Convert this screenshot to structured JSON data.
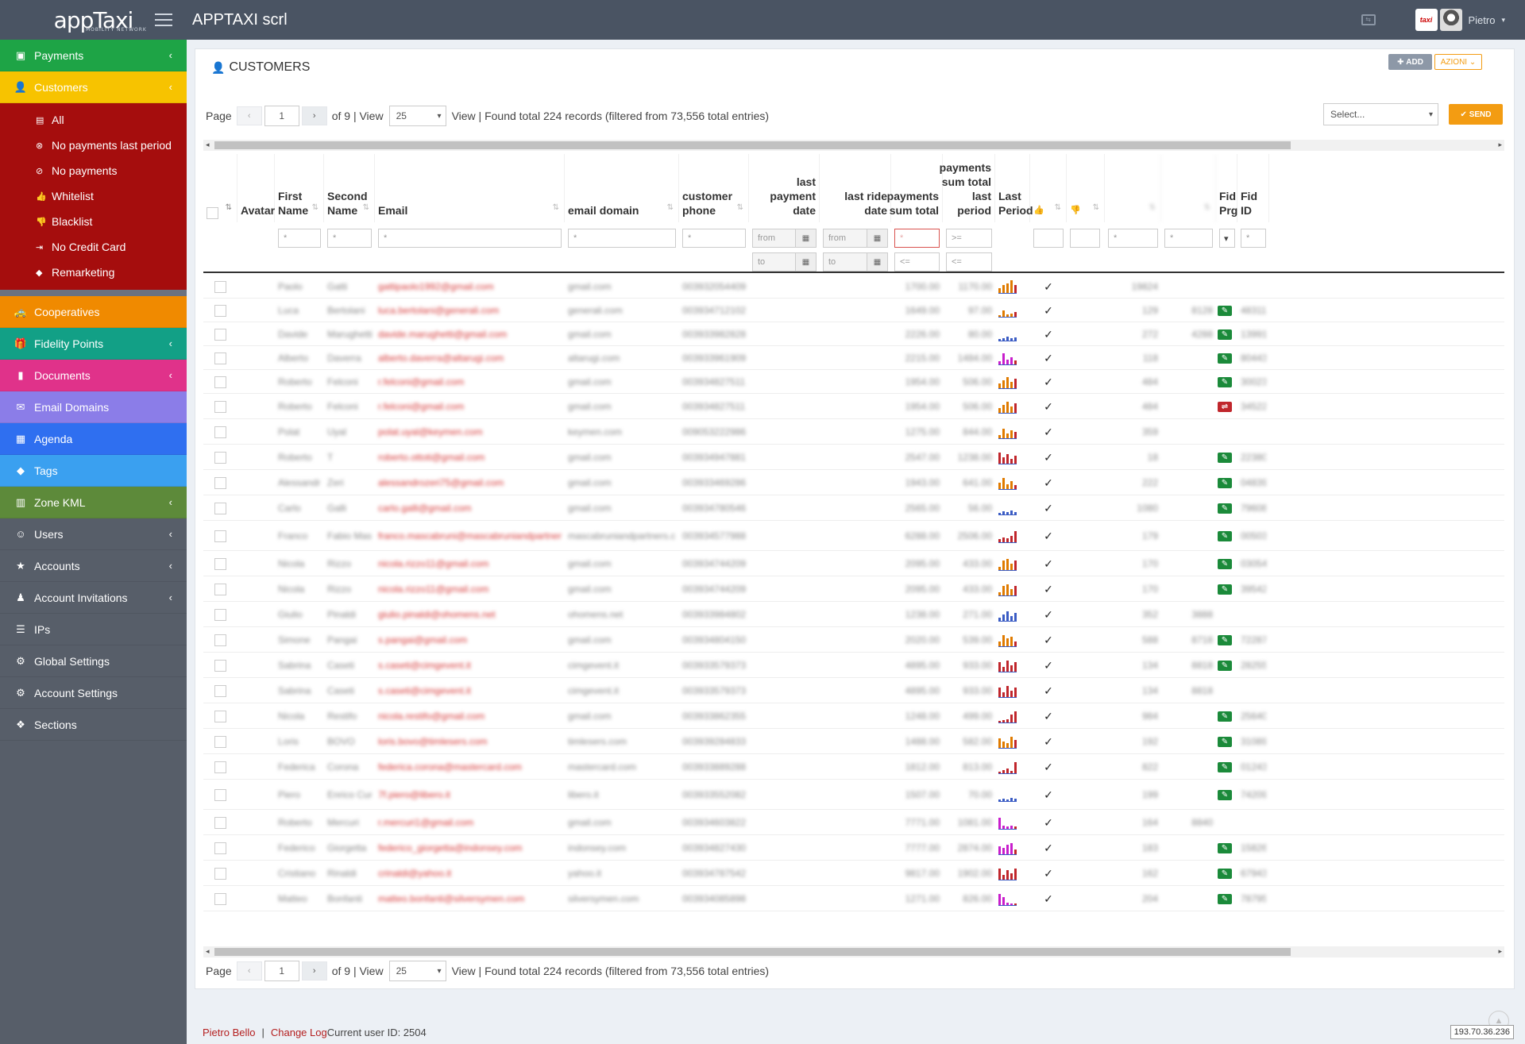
{
  "app": {
    "logo": "appTaxi",
    "logo_sub": "MOBILITY NETWORK",
    "title": "APPTAXI scrl",
    "user": "Pietro"
  },
  "sidebar": {
    "items": [
      {
        "label": "Payments",
        "icon": "money-icon",
        "color": "#1ea446",
        "chev": "‹"
      },
      {
        "label": "Customers",
        "icon": "user-icon",
        "color": "#f7c300",
        "chev": "‹",
        "active": true
      }
    ],
    "customers_sub": [
      {
        "label": "All",
        "icon": "list-icon",
        "glyph": "▤"
      },
      {
        "label": "No payments last period",
        "icon": "ban-icon",
        "glyph": "⊗"
      },
      {
        "label": "No payments",
        "icon": "ban-circle-icon",
        "glyph": "⊘"
      },
      {
        "label": "Whitelist",
        "icon": "thumbs-up-icon",
        "glyph": "👍"
      },
      {
        "label": "Blacklist",
        "icon": "thumbs-down-icon",
        "glyph": "👎"
      },
      {
        "label": "No Credit Card",
        "icon": "sign-in-icon",
        "glyph": "⇥"
      },
      {
        "label": "Remarketing",
        "icon": "tag-icon",
        "glyph": "◆"
      }
    ],
    "items2": [
      {
        "label": "Cooperatives",
        "icon": "car-icon",
        "glyph": "🚕",
        "color": "#f08a00",
        "chev": ""
      },
      {
        "label": "Fidelity Points",
        "icon": "gift-icon",
        "glyph": "🎁",
        "color": "#12a086",
        "chev": "‹"
      },
      {
        "label": "Documents",
        "icon": "book-icon",
        "glyph": "▮",
        "color": "#e0328a",
        "chev": "‹"
      },
      {
        "label": "Email Domains",
        "icon": "envelope-icon",
        "glyph": "✉",
        "color": "#8b7de8",
        "chev": ""
      },
      {
        "label": "Agenda",
        "icon": "calendar-icon",
        "glyph": "▦",
        "color": "#2f6ff0",
        "chev": ""
      },
      {
        "label": "Tags",
        "icon": "tag-icon",
        "glyph": "◆",
        "color": "#3aa0f0",
        "chev": ""
      },
      {
        "label": "Zone KML",
        "icon": "map-icon",
        "glyph": "▥",
        "color": "#5d8a3a",
        "chev": "‹"
      },
      {
        "label": "Users",
        "icon": "users-icon",
        "glyph": "☺",
        "color": "#575e69",
        "chev": "‹"
      },
      {
        "label": "Accounts",
        "icon": "star-icon",
        "glyph": "★",
        "color": "#575e69",
        "chev": "‹"
      },
      {
        "label": "Account Invitations",
        "icon": "user-plus-icon",
        "glyph": "♟",
        "color": "#575e69",
        "chev": "‹"
      },
      {
        "label": "IPs",
        "icon": "server-icon",
        "glyph": "☰",
        "color": "#575e69",
        "chev": ""
      },
      {
        "label": "Global Settings",
        "icon": "gear-icon",
        "glyph": "⚙",
        "color": "#575e69",
        "chev": ""
      },
      {
        "label": "Account Settings",
        "icon": "gears-icon",
        "glyph": "⚙",
        "color": "#575e69",
        "chev": ""
      },
      {
        "label": "Sections",
        "icon": "cubes-icon",
        "glyph": "❖",
        "color": "#575e69",
        "chev": ""
      }
    ]
  },
  "box": {
    "title": "CUSTOMERS",
    "add_label": "ADD",
    "azioni_label": "AZIONI",
    "select_placeholder": "Select...",
    "send_label": "SEND"
  },
  "pager": {
    "page_label": "Page",
    "prev": "‹",
    "next": "›",
    "page": "1",
    "of_label": "of 9 | View",
    "view": "25",
    "found_text": "View | Found total 224 records (filtered from 73,556 total entries)"
  },
  "columns": [
    {
      "label": "Avatar"
    },
    {
      "label": "First Name"
    },
    {
      "label": "Second Name"
    },
    {
      "label": "Email"
    },
    {
      "label": "email domain"
    },
    {
      "label": "customer phone"
    },
    {
      "label": "last payment date"
    },
    {
      "label": "last ride date"
    },
    {
      "label": "payments sum total"
    },
    {
      "label": "payments sum total last period"
    },
    {
      "label": "Last Period"
    },
    {
      "label": "Fid Prg"
    },
    {
      "label": "Fid ID"
    }
  ],
  "filters": {
    "wildcard": "*",
    "from": "from",
    "to": "to",
    "gte": ">=",
    "lte": "<="
  },
  "rows": [
    {
      "first": "Paolo",
      "second": "Gatti",
      "email": "gattipaolo1992@gmail.com",
      "domain": "gmail.com",
      "phone": "00393205440933",
      "sum": "1700.00",
      "sumlp": "1170.00",
      "spark": [
        6,
        10,
        12,
        16,
        10
      ],
      "sc": "#e07b00",
      "wl": "19824",
      "bl": "",
      "fid": "",
      "fidid": ""
    },
    {
      "first": "Luca",
      "second": "Bertolani",
      "email": "luca.bertolani@generali.com",
      "domain": "generali.com",
      "phone": "00393471210292",
      "sum": "1649.00",
      "sumlp": "97.00",
      "spark": [
        2,
        8,
        3,
        4,
        6
      ],
      "sc": "#e07b00",
      "wl": "129",
      "bl": "8128",
      "fid": "g",
      "fidid": "48311"
    },
    {
      "first": "Davide",
      "second": "Marughetti",
      "email": "davide.marughetti@gmail.com",
      "domain": "gmail.com",
      "phone": "00393398282859",
      "sum": "2226.00",
      "sumlp": "80.00",
      "spark": [
        2,
        3,
        5,
        3,
        4
      ],
      "sc": "#3b5cc4",
      "wl": "272",
      "bl": "4288",
      "fid": "g",
      "fidid": "13991"
    },
    {
      "first": "Alberto",
      "second": "Daverra",
      "email": "alberto.daverra@altarugi.com",
      "domain": "altarugi.com",
      "phone": "00393396190903",
      "sum": "2215.00",
      "sumlp": "1484.00",
      "spark": [
        4,
        14,
        6,
        9,
        5
      ],
      "sc": "#c81ecc",
      "wl": "118",
      "bl": "",
      "fid": "g",
      "fidid": "80443"
    },
    {
      "first": "Roberto",
      "second": "Felconi",
      "email": "r.felconi@gmail.com",
      "domain": "gmail.com",
      "phone": "00393482751124",
      "sum": "1954.00",
      "sumlp": "506.00",
      "spark": [
        6,
        10,
        14,
        8,
        12
      ],
      "sc": "#e07b00",
      "wl": "484",
      "bl": "",
      "fid": "g",
      "fidid": "30023"
    },
    {
      "first": "Roberto",
      "second": "Felconi",
      "email": "r.felconi@gmail.com",
      "domain": "gmail.com",
      "phone": "00393482751124",
      "sum": "1954.00",
      "sumlp": "506.00",
      "spark": [
        6,
        10,
        14,
        8,
        12
      ],
      "sc": "#e07b00",
      "wl": "484",
      "bl": "",
      "fid": "r",
      "fidid": "34522"
    },
    {
      "first": "Polat",
      "second": "Uyal",
      "email": "polat.uyal@keymen.com",
      "domain": "keymen.com",
      "phone": "00905322298651",
      "sum": "1275.00",
      "sumlp": "844.00",
      "spark": [
        4,
        12,
        6,
        10,
        8
      ],
      "sc": "#e07b00",
      "wl": "359",
      "bl": "",
      "fid": "",
      "fidid": ""
    },
    {
      "first": "Roberto",
      "second": "T",
      "email": "roberto.ottoti@gmail.com",
      "domain": "gmail.com",
      "phone": "00393494788184",
      "sum": "2547.00",
      "sumlp": "1238.00",
      "spark": [
        14,
        8,
        12,
        6,
        10
      ],
      "sc": "#c0262c",
      "wl": "18",
      "bl": "",
      "fid": "g",
      "fidid": "22380"
    },
    {
      "first": "Alessandro",
      "second": "Zeri",
      "email": "alessandrozeri75@gmail.com",
      "domain": "gmail.com",
      "phone": "00393346928608",
      "sum": "1943.00",
      "sumlp": "641.00",
      "spark": [
        8,
        14,
        6,
        10,
        5
      ],
      "sc": "#e07b00",
      "wl": "222",
      "bl": "",
      "fid": "g",
      "fidid": "04839"
    },
    {
      "first": "Carlo",
      "second": "Galli",
      "email": "carlo.galli@gmail.com",
      "domain": "gmail.com",
      "phone": "00393478054693",
      "sum": "2565.00",
      "sumlp": "56.00",
      "spark": [
        2,
        4,
        3,
        5,
        3
      ],
      "sc": "#3b5cc4",
      "wl": "1080",
      "bl": "",
      "fid": "g",
      "fidid": "79608"
    },
    {
      "first": "Franco",
      "second": "Fabio Mascabruni",
      "email": "franco.mascabruni@mascabruniandpartners.com",
      "domain": "mascabruniandpartners.com",
      "phone": "00393457798888",
      "sum": "6288.00",
      "sumlp": "2506.00",
      "spark": [
        4,
        6,
        5,
        8,
        14
      ],
      "sc": "#c0262c",
      "wl": "179",
      "bl": "",
      "fid": "g",
      "fidid": "00503"
    },
    {
      "first": "Nicola",
      "second": "Rizzo",
      "email": "nicola.rizzo11@gmail.com",
      "domain": "gmail.com",
      "phone": "00393474420987",
      "sum": "2095.00",
      "sumlp": "433.00",
      "spark": [
        4,
        12,
        14,
        8,
        12
      ],
      "sc": "#e07b00",
      "wl": "170",
      "bl": "",
      "fid": "g",
      "fidid": "03054"
    },
    {
      "first": "Nicola",
      "second": "Rizzo",
      "email": "nicola.rizzo11@gmail.com",
      "domain": "gmail.com",
      "phone": "00393474420987",
      "sum": "2095.00",
      "sumlp": "433.00",
      "spark": [
        4,
        12,
        14,
        8,
        12
      ],
      "sc": "#e07b00",
      "wl": "170",
      "bl": "",
      "fid": "g",
      "fidid": "39542"
    },
    {
      "first": "Giulio",
      "second": "Pinaldi",
      "email": "giulio.pinaldi@ohomens.net",
      "domain": "ohomens.net",
      "phone": "00393398480248",
      "sum": "1238.00",
      "sumlp": "271.00",
      "spark": [
        4,
        8,
        12,
        6,
        10
      ],
      "sc": "#3b5cc4",
      "wl": "352",
      "bl": "3888",
      "fid": "",
      "fidid": ""
    },
    {
      "first": "Simone",
      "second": "Pangai",
      "email": "s.pangai@gmail.com",
      "domain": "gmail.com",
      "phone": "00393480415050",
      "sum": "2020.00",
      "sumlp": "539.00",
      "spark": [
        6,
        14,
        10,
        12,
        6
      ],
      "sc": "#e07b00",
      "wl": "588",
      "bl": "8718",
      "fid": "g",
      "fidid": "72287"
    },
    {
      "first": "Sabrina",
      "second": "Caseti",
      "email": "s.caseti@cimgevent.it",
      "domain": "cimgevent.it",
      "phone": "00393357937382",
      "sum": "4895.00",
      "sumlp": "933.00",
      "spark": [
        12,
        6,
        14,
        8,
        12
      ],
      "sc": "#c0262c",
      "wl": "134",
      "bl": "8818",
      "fid": "g",
      "fidid": "28255"
    },
    {
      "first": "Sabrina",
      "second": "Caseti",
      "email": "s.caseti@cimgevent.it",
      "domain": "cimgevent.it",
      "phone": "00393357937382",
      "sum": "4895.00",
      "sumlp": "933.00",
      "spark": [
        12,
        6,
        14,
        8,
        12
      ],
      "sc": "#c0262c",
      "wl": "134",
      "bl": "8818",
      "fid": "",
      "fidid": ""
    },
    {
      "first": "Nicola",
      "second": "Restifo",
      "email": "nicola.restifo@gmail.com",
      "domain": "gmail.com",
      "phone": "00393386235579",
      "sum": "1248.00",
      "sumlp": "499.00",
      "spark": [
        2,
        3,
        4,
        10,
        14
      ],
      "sc": "#c0262c",
      "wl": "984",
      "bl": "",
      "fid": "g",
      "fidid": "25640"
    },
    {
      "first": "Loris",
      "second": "BOVO",
      "email": "loris.bovo@timlesers.com",
      "domain": "timlesers.com",
      "phone": "00393928483300",
      "sum": "1488.00",
      "sumlp": "582.00",
      "spark": [
        12,
        8,
        6,
        14,
        10
      ],
      "sc": "#e07b00",
      "wl": "192",
      "bl": "",
      "fid": "g",
      "fidid": "31089"
    },
    {
      "first": "Federica",
      "second": "Corona",
      "email": "federica.corona@mastercard.com",
      "domain": "mastercard.com",
      "phone": "00393388928824",
      "sum": "1812.00",
      "sumlp": "813.00",
      "spark": [
        2,
        4,
        6,
        3,
        14
      ],
      "sc": "#c0262c",
      "wl": "822",
      "bl": "",
      "fid": "g",
      "fidid": "01243"
    },
    {
      "first": "Piero",
      "second": "Enrico Cureni",
      "email": "7f.piero@libero.it",
      "domain": "libero.it",
      "phone": "00393355208200",
      "sum": "1507.00",
      "sumlp": "70.00",
      "spark": [
        2,
        3,
        2,
        4,
        3
      ],
      "sc": "#3b5cc4",
      "wl": "199",
      "bl": "",
      "fid": "g",
      "fidid": "74209"
    },
    {
      "first": "Roberto",
      "second": "Mercuri",
      "email": "r.mercuri1@gmail.com",
      "domain": "gmail.com",
      "phone": "00393460382280",
      "sum": "7771.00",
      "sumlp": "1081.00",
      "spark": [
        14,
        4,
        3,
        4,
        3
      ],
      "sc": "#c81ecc",
      "wl": "164",
      "bl": "8840",
      "fid": "",
      "fidid": ""
    },
    {
      "first": "Federico",
      "second": "Giorgetta",
      "email": "federico_giorgetta@indonsey.com",
      "domain": "indonsey.com",
      "phone": "00393482743019",
      "sum": "7777.00",
      "sumlp": "2874.00",
      "spark": [
        10,
        8,
        12,
        14,
        6
      ],
      "sc": "#c81ecc",
      "wl": "183",
      "bl": "",
      "fid": "g",
      "fidid": "15826"
    },
    {
      "first": "Cristiano",
      "second": "Rinaldi",
      "email": "crinaldi@yahoo.it",
      "domain": "yahoo.it",
      "phone": "00393478754283",
      "sum": "9817.00",
      "sumlp": "1902.00",
      "spark": [
        14,
        6,
        12,
        8,
        14
      ],
      "sc": "#c0262c",
      "wl": "162",
      "bl": "",
      "fid": "g",
      "fidid": "67943"
    },
    {
      "first": "Matteo",
      "second": "Bonfanti",
      "email": "matteo.bonfanti@silversymen.com",
      "domain": "silversymen.com",
      "phone": "00393408589843",
      "sum": "1271.00",
      "sumlp": "826.00",
      "spark": [
        14,
        10,
        3,
        2,
        2
      ],
      "sc": "#c81ecc",
      "wl": "204",
      "bl": "",
      "fid": "g",
      "fidid": "78795"
    }
  ],
  "footer": {
    "user_link": "Pietro Bello",
    "separator": "|",
    "changelog_link": "Change Log",
    "current_user": "Current user ID: 2504",
    "ip": "193.70.36.236"
  }
}
